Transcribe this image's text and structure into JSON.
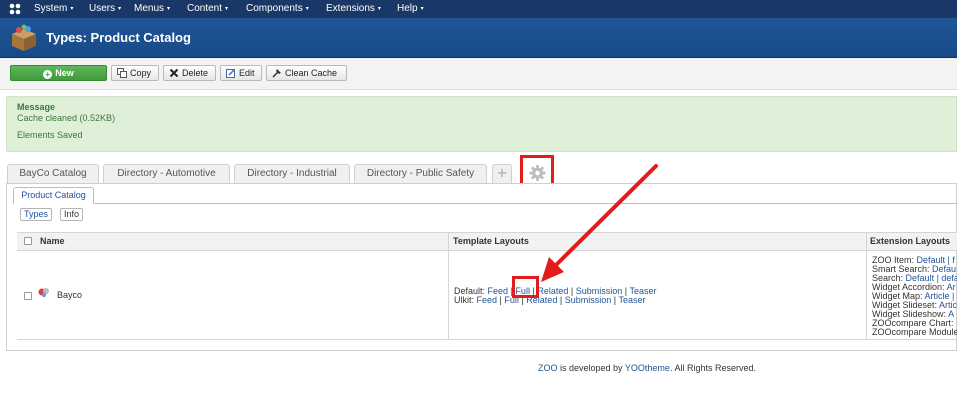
{
  "menubar": {
    "items": [
      {
        "label": "System"
      },
      {
        "label": "Users"
      },
      {
        "label": "Menus"
      },
      {
        "label": "Content"
      },
      {
        "label": "Components"
      },
      {
        "label": "Extensions"
      },
      {
        "label": "Help"
      }
    ],
    "caret": "▾"
  },
  "header": {
    "title": "Types: Product Catalog"
  },
  "toolbar": {
    "new_label": "New",
    "copy_label": "Copy",
    "delete_label": "Delete",
    "edit_label": "Edit",
    "clean_cache_label": "Clean Cache"
  },
  "message": {
    "heading": "Message",
    "line1": "Cache cleaned (0.52KB)",
    "line2": "Elements Saved"
  },
  "tabs": [
    {
      "label": "BayCo Catalog"
    },
    {
      "label": "Directory - Automotive"
    },
    {
      "label": "Directory - Industrial"
    },
    {
      "label": "Directory - Public Safety"
    }
  ],
  "subtab": {
    "label": "Product Catalog"
  },
  "pills": {
    "types": "Types",
    "info": "Info"
  },
  "table": {
    "headers": {
      "name": "Name",
      "template_layouts": "Template Layouts",
      "extension_layouts": "Extension Layouts"
    },
    "row": {
      "name": "Bayco",
      "default_label": "Default:",
      "uikit_label": "Ulkit:",
      "layouts": [
        "Feed",
        "Full",
        "Related",
        "Submission",
        "Teaser"
      ],
      "separator": "|",
      "extension_lines": [
        {
          "label": "ZOO Item:",
          "links": "Default | f"
        },
        {
          "label": "Smart Search:",
          "links": "Defau"
        },
        {
          "label": "Search:",
          "links": "Default | defa"
        },
        {
          "label": "Widget Accordion:",
          "links": "Ar"
        },
        {
          "label": "Widget Map:",
          "links": "Article | "
        },
        {
          "label": "Widget Slideset:",
          "links": "Artic"
        },
        {
          "label": "Widget Slideshow:",
          "links": "A"
        },
        {
          "label": "ZOOcompare Chart:",
          "links": ""
        },
        {
          "label": "ZOOcompare Module",
          "links": ""
        }
      ]
    }
  },
  "footer": {
    "zoo": "ZOO",
    "middle": "is developed by",
    "yootheme": "YOOtheme",
    "end": ". All Rights Reserved."
  },
  "colors": {
    "menubar": "#1a3867",
    "header": "#1f5597",
    "new_button": "#4aa847",
    "message_bg": "#dff0d8",
    "highlight_red": "#e21c1c",
    "link": "#1f5597"
  }
}
